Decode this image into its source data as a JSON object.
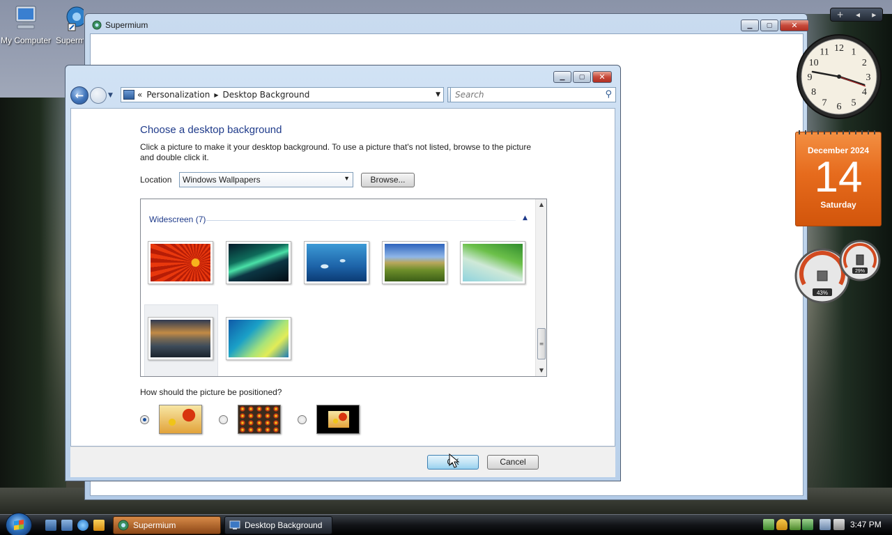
{
  "desktop": {
    "icons": [
      {
        "label": "My Computer"
      },
      {
        "label": "Supermium"
      }
    ]
  },
  "browser_window": {
    "title": "Supermium"
  },
  "dialog": {
    "nav": {
      "breadcrumbs": [
        "Personalization",
        "Desktop Background"
      ],
      "search_placeholder": "Search",
      "breadcrumb_prefix": "«"
    },
    "heading": "Choose a desktop background",
    "description": "Click a picture to make it your desktop background. To use a picture that's not listed, browse to the picture and double click it.",
    "location_label": "Location",
    "location_value": "Windows Wallpapers",
    "browse_label": "Browse...",
    "gallery": {
      "group_label": "Widescreen (7)",
      "wallpapers": [
        "red-flower",
        "aurora",
        "dolphins",
        "hills",
        "palm-leaf",
        "mountain-lake",
        "vista-aurora"
      ],
      "selected_index": 5
    },
    "position_question": "How should the picture be positioned?",
    "position_options": [
      "fit-to-screen",
      "tile",
      "center"
    ],
    "position_selected": 0,
    "ok_label": "OK",
    "cancel_label": "Cancel"
  },
  "gadgets": {
    "calendar": {
      "month": "December 2024",
      "day": "14",
      "weekday": "Saturday"
    },
    "clock_numbers": [
      "12",
      "1",
      "2",
      "3",
      "4",
      "5",
      "6",
      "7",
      "8",
      "9",
      "10",
      "11"
    ],
    "cpu_meter": {
      "cpu": "43%",
      "memory": "29%"
    }
  },
  "taskbar": {
    "buttons": [
      {
        "label": "Supermium"
      },
      {
        "label": "Desktop Background"
      }
    ],
    "time": "3:47 PM"
  },
  "colors": {
    "accent": "#1e3a8a",
    "calendar": "#e66b1d",
    "taskbar_active": "#c0743a"
  }
}
